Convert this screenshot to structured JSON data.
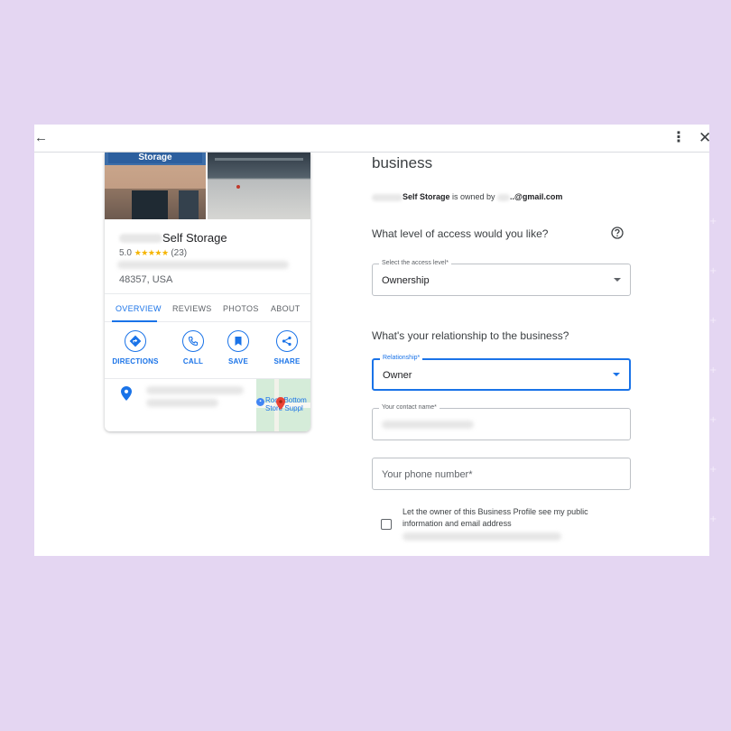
{
  "window": {
    "back_icon": "arrow-left-icon",
    "more_icon": "more-vertical-icon",
    "close_icon": "close-icon",
    "back_glyph": "←",
    "more_glyph": "⋮",
    "close_glyph": "✕"
  },
  "card": {
    "sign_text": "Storage",
    "name_suffix": "Self Storage",
    "rating": "5.0",
    "stars": "★★★★★",
    "review_count": "(23)",
    "zip": "48357, USA",
    "tabs": [
      {
        "label": "OVERVIEW",
        "active": true
      },
      {
        "label": "REVIEWS",
        "active": false
      },
      {
        "label": "PHOTOS",
        "active": false
      },
      {
        "label": "ABOUT",
        "active": false
      }
    ],
    "actions": [
      {
        "label": "DIRECTIONS",
        "icon": "directions-icon"
      },
      {
        "label": "CALL",
        "icon": "phone-icon"
      },
      {
        "label": "SAVE",
        "icon": "bookmark-icon"
      },
      {
        "label": "SHARE",
        "icon": "share-icon"
      }
    ],
    "map_label": "Rock Bottom Store Suppl",
    "map_label_line1": "Rock Bottom",
    "map_label_line2": "Store Suppl"
  },
  "form": {
    "title": "business",
    "owned_business": "Self Storage",
    "owned_mid": " is owned by ",
    "owned_email_suffix": "..@gmail.com",
    "access_question": "What level of access would you like?",
    "access_field": {
      "label": "Select the access level*",
      "value": "Ownership"
    },
    "relationship_question": "What's your relationship to the business?",
    "relationship_field": {
      "label": "Relationship*",
      "value": "Owner"
    },
    "contact_field": {
      "label": "Your contact name*"
    },
    "phone_field": {
      "placeholder": "Your phone number*"
    },
    "consent_text": "Let the owner of this Business Profile see my public information and email address"
  },
  "colors": {
    "accent": "#1a73e8",
    "star": "#f5b400",
    "background": "#e4d6f2"
  }
}
